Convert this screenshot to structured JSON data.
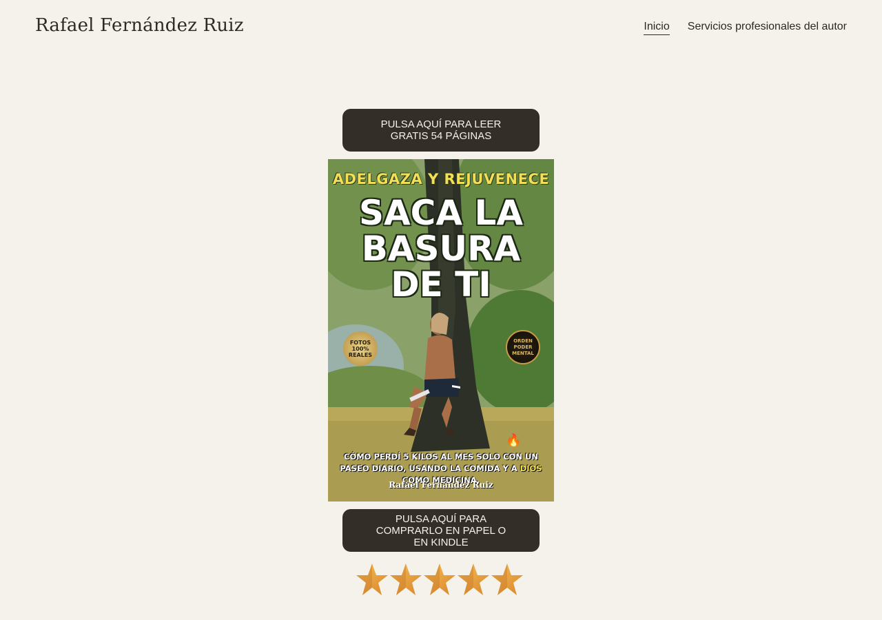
{
  "header": {
    "site_title": "Rafael Fernández Ruiz",
    "nav": [
      {
        "label": "Inicio",
        "active": true
      },
      {
        "label": "Servicios profesionales del autor",
        "active": false
      }
    ]
  },
  "main": {
    "cta_read": "PULSA AQUÍ PARA LEER GRATIS 54 PÁGINAS",
    "cover": {
      "top_line": "ADELGAZA Y REJUVENECE",
      "title_line1": "SACA LA",
      "title_line2": "BASURA",
      "title_line3": "DE TI",
      "badge_left": "FOTOS 100% REALES",
      "badge_right": "ORDEN PODER MENTAL",
      "subtitle_pre": "CÓMO PERDÍ 5 KILOS AL MES SOLO CON UN PASEO DIARIO, USANDO LA COMIDA Y A ",
      "subtitle_highlight": "DIOS",
      "subtitle_post": " COMO MEDICINA.",
      "author": "Rafael Fernández Ruiz"
    },
    "cta_buy": "PULSA AQUÍ PARA COMPRARLO EN PAPEL O EN KINDLE",
    "rating_stars": 5
  },
  "colors": {
    "background": "#f5f2eb",
    "button_bg": "#332e28",
    "button_text": "#f5f2eb",
    "star": "#e9a23a"
  }
}
